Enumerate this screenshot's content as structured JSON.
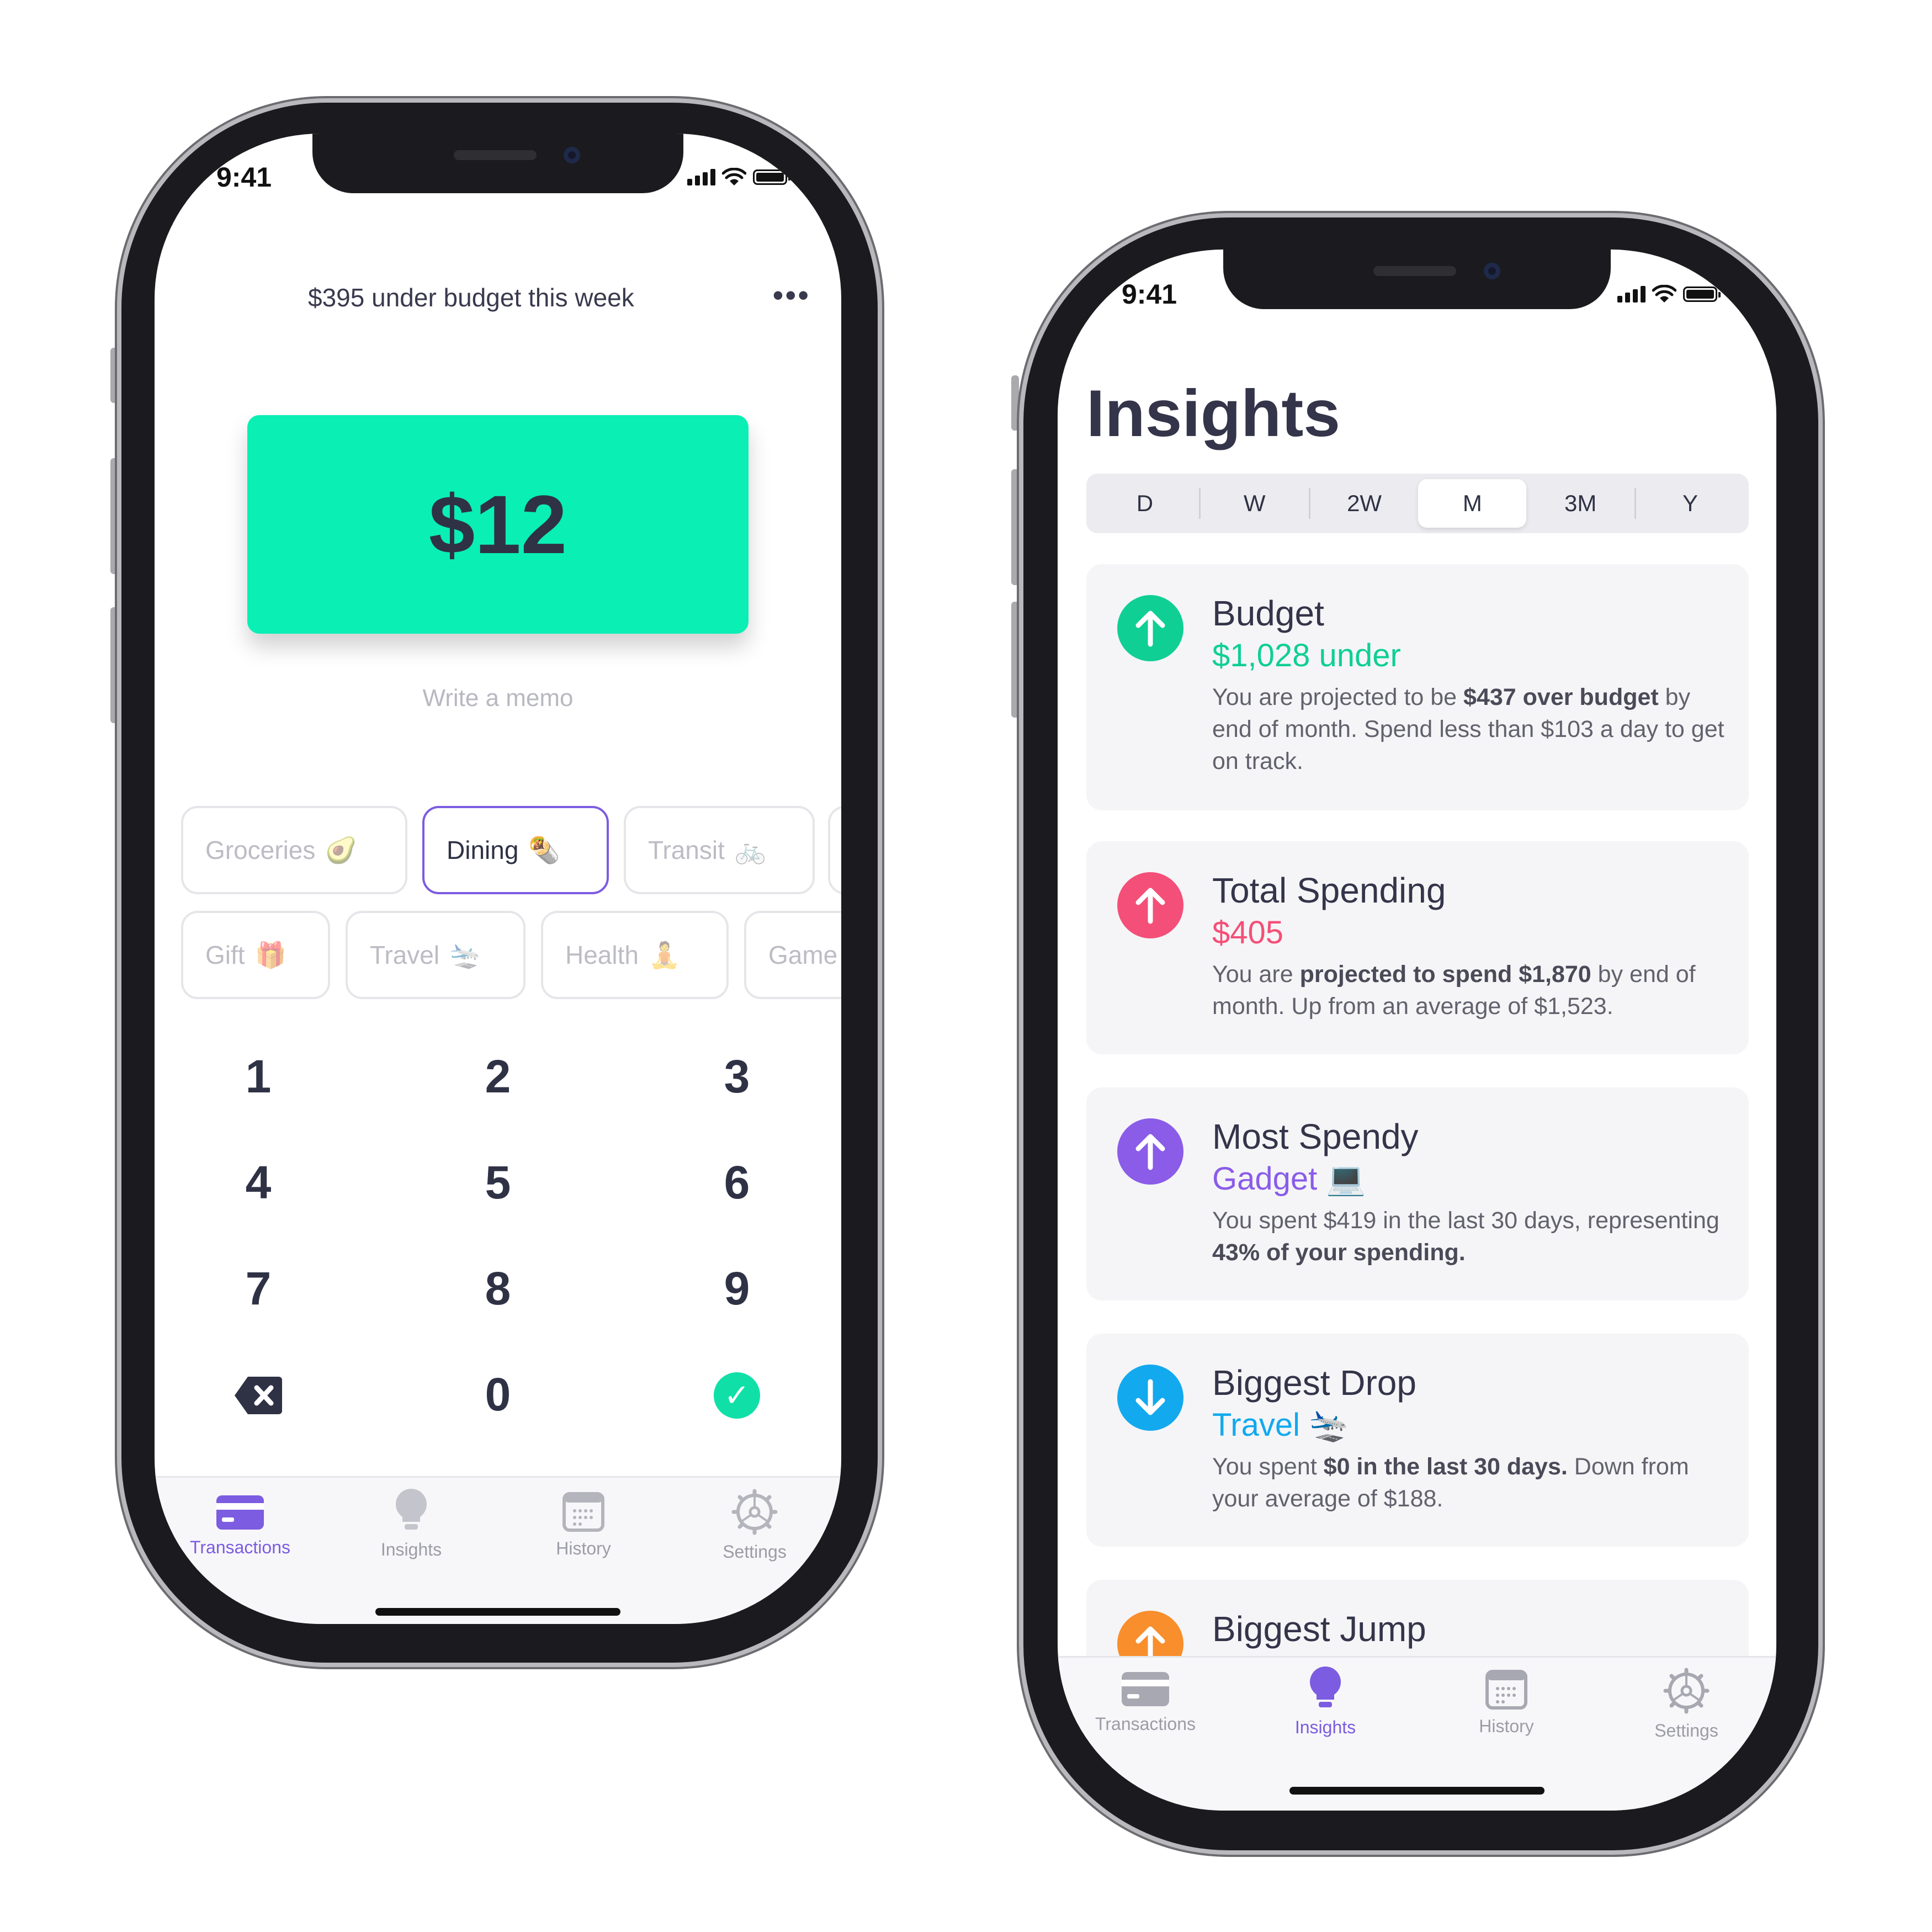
{
  "left_phone": {
    "status": {
      "time": "9:41"
    },
    "header": {
      "text": "$395 under budget this week",
      "more": "•••"
    },
    "amount": "$12",
    "memo_placeholder": "Write a memo",
    "categories_row1": [
      {
        "label": "Groceries",
        "emoji": "🥑"
      },
      {
        "label": "Dining",
        "emoji": "🌯"
      },
      {
        "label": "Transit",
        "emoji": "🚲"
      }
    ],
    "categories_row2": [
      {
        "label": "Gift",
        "emoji": "🎁"
      },
      {
        "label": "Travel",
        "emoji": "🛬"
      },
      {
        "label": "Health",
        "emoji": "🧘"
      },
      {
        "label": "Game",
        "emoji": ""
      }
    ],
    "keypad": [
      "1",
      "2",
      "3",
      "4",
      "5",
      "6",
      "7",
      "8",
      "9",
      "0"
    ],
    "tabs": [
      "Transactions",
      "Insights",
      "History",
      "Settings"
    ]
  },
  "right_phone": {
    "status": {
      "time": "9:41"
    },
    "title": "Insights",
    "periods": [
      "D",
      "W",
      "2W",
      "M",
      "3M",
      "Y"
    ],
    "selected_period": "M",
    "cards": [
      {
        "title": "Budget",
        "value": "$1,028 under",
        "color": "#0fcf94",
        "desc_pre": "You are projected to be ",
        "desc_bold": "$437 over budget",
        "desc_post": " by end of month. Spend less than $103 a day to get on track."
      },
      {
        "title": "Total Spending",
        "value": "$405",
        "color": "#f44f78",
        "desc_pre": "You are ",
        "desc_bold": "projected to spend $1,870",
        "desc_post": " by end of month. Up from an average of $1,523."
      },
      {
        "title": "Most Spendy",
        "value": "Gadget",
        "emoji": "💻",
        "color": "#8a5ce8",
        "desc_pre": "You spent $419 in the last 30 days, representing ",
        "desc_bold": "43% of your spending.",
        "desc_post": ""
      },
      {
        "title": "Biggest Drop",
        "value": "Travel",
        "emoji": "🛬",
        "color": "#12a9ef",
        "desc_pre": "You spent ",
        "desc_bold": "$0 in the last 30 days.",
        "desc_post": " Down from your average of $188."
      },
      {
        "title": "Biggest Jump",
        "color": "#f88e2c"
      }
    ],
    "tabs": [
      "Transactions",
      "Insights",
      "History",
      "Settings"
    ]
  },
  "colors": {
    "accent": "#7c5ce0",
    "mint": "#0aefb4"
  }
}
